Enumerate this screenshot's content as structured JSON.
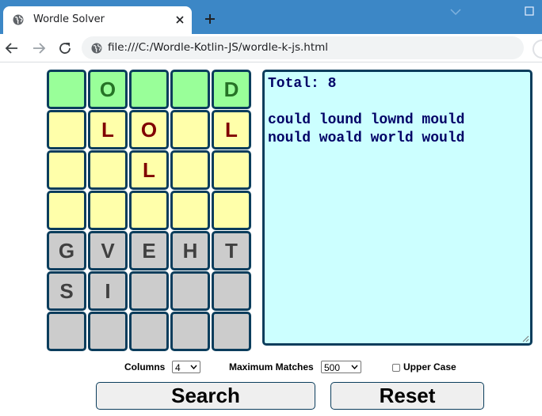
{
  "browser": {
    "tab_title": "Wordle Solver",
    "url": "file:///C:/Wordle-Kotlin-JS/wordle-k-js.html"
  },
  "colors": {
    "green": "#99ff99",
    "yellow": "#ffffaa",
    "gray": "#cccccc",
    "green_text": "#267326",
    "yellow_text": "#800000",
    "gray_text": "#404040",
    "results_bg": "#ccffff"
  },
  "grid": {
    "rows": [
      {
        "type": "green",
        "letters": [
          "",
          "O",
          "",
          "",
          "D"
        ]
      },
      {
        "type": "yellow",
        "letters": [
          "",
          "L",
          "O",
          "",
          "L"
        ]
      },
      {
        "type": "yellow",
        "letters": [
          "",
          "",
          "L",
          "",
          ""
        ]
      },
      {
        "type": "yellow",
        "letters": [
          "",
          "",
          "",
          "",
          ""
        ]
      },
      {
        "type": "gray",
        "letters": [
          "G",
          "V",
          "E",
          "H",
          "T"
        ]
      },
      {
        "type": "gray",
        "letters": [
          "S",
          "I",
          "",
          "",
          ""
        ]
      },
      {
        "type": "gray",
        "letters": [
          "",
          "",
          "",
          "",
          ""
        ]
      }
    ]
  },
  "results": {
    "text": "Total: 8\n\ncould lound lownd mould\nnould woald world would"
  },
  "controls": {
    "columns_label": "Columns",
    "columns_value": "4",
    "max_matches_label": "Maximum Matches",
    "max_matches_value": "500",
    "upper_case_label": "Upper Case",
    "upper_case_checked": false,
    "search_label": "Search",
    "reset_label": "Reset"
  }
}
